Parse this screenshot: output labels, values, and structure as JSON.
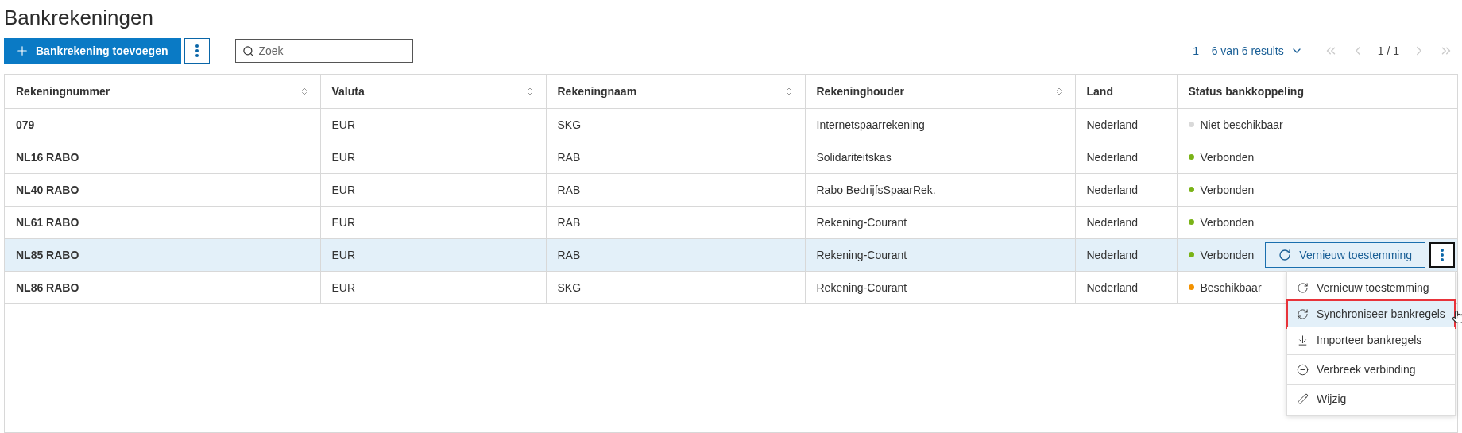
{
  "title": "Bankrekeningen",
  "toolbar": {
    "add_button": "Bankrekening toevoegen",
    "search": {
      "placeholder": "Zoek"
    }
  },
  "pagination": {
    "summary": "1 – 6 van 6 results",
    "page": "1 / 1"
  },
  "table": {
    "columns": [
      {
        "label": "Rekeningnummer",
        "sortable": true
      },
      {
        "label": "Valuta",
        "sortable": true
      },
      {
        "label": "Rekeningnaam",
        "sortable": true
      },
      {
        "label": "Rekeninghouder",
        "sortable": true
      },
      {
        "label": "Land",
        "sortable": false
      },
      {
        "label": "Status bankkoppeling",
        "sortable": false
      }
    ],
    "rows": [
      {
        "cells": [
          "079",
          "EUR",
          "SKG",
          "Internetspaarrekening",
          "Nederland"
        ],
        "status": {
          "label": "Niet beschikbaar",
          "color": "#d9d9d9"
        },
        "selected": false
      },
      {
        "cells": [
          "NL16 RABO",
          "EUR",
          "RAB",
          "Solidariteitskas",
          "Nederland"
        ],
        "status": {
          "label": "Verbonden",
          "color": "#7ab317"
        },
        "selected": false
      },
      {
        "cells": [
          "NL40 RABO",
          "EUR",
          "RAB",
          "Rabo BedrijfsSpaarRek.",
          "Nederland"
        ],
        "status": {
          "label": "Verbonden",
          "color": "#7ab317"
        },
        "selected": false
      },
      {
        "cells": [
          "NL61 RABO",
          "EUR",
          "RAB",
          "Rekening-Courant",
          "Nederland"
        ],
        "status": {
          "label": "Verbonden",
          "color": "#7ab317"
        },
        "selected": false
      },
      {
        "cells": [
          "NL85 RABO",
          "EUR",
          "RAB",
          "Rekening-Courant",
          "Nederland"
        ],
        "status": {
          "label": "Verbonden",
          "color": "#7ab317"
        },
        "selected": true,
        "action_button": "Vernieuw toestemming"
      },
      {
        "cells": [
          "NL86 RABO",
          "EUR",
          "SKG",
          "Rekening-Courant",
          "Nederland"
        ],
        "status": {
          "label": "Beschikbaar",
          "color": "#f39200"
        },
        "selected": false
      }
    ]
  },
  "menu": {
    "items": [
      {
        "label": "Vernieuw toestemming",
        "kind": "refresh",
        "selected": false,
        "separator_before": false
      },
      {
        "label": "Synchroniseer bankregels",
        "kind": "sync",
        "selected": true,
        "separator_before": false
      },
      {
        "label": "Importeer bankregels",
        "kind": "download",
        "selected": false,
        "separator_before": false
      },
      {
        "label": "Verbreek verbinding",
        "kind": "disconnect",
        "selected": false,
        "separator_before": true
      },
      {
        "label": "Wijzig",
        "kind": "edit",
        "selected": false,
        "separator_before": true
      }
    ]
  }
}
